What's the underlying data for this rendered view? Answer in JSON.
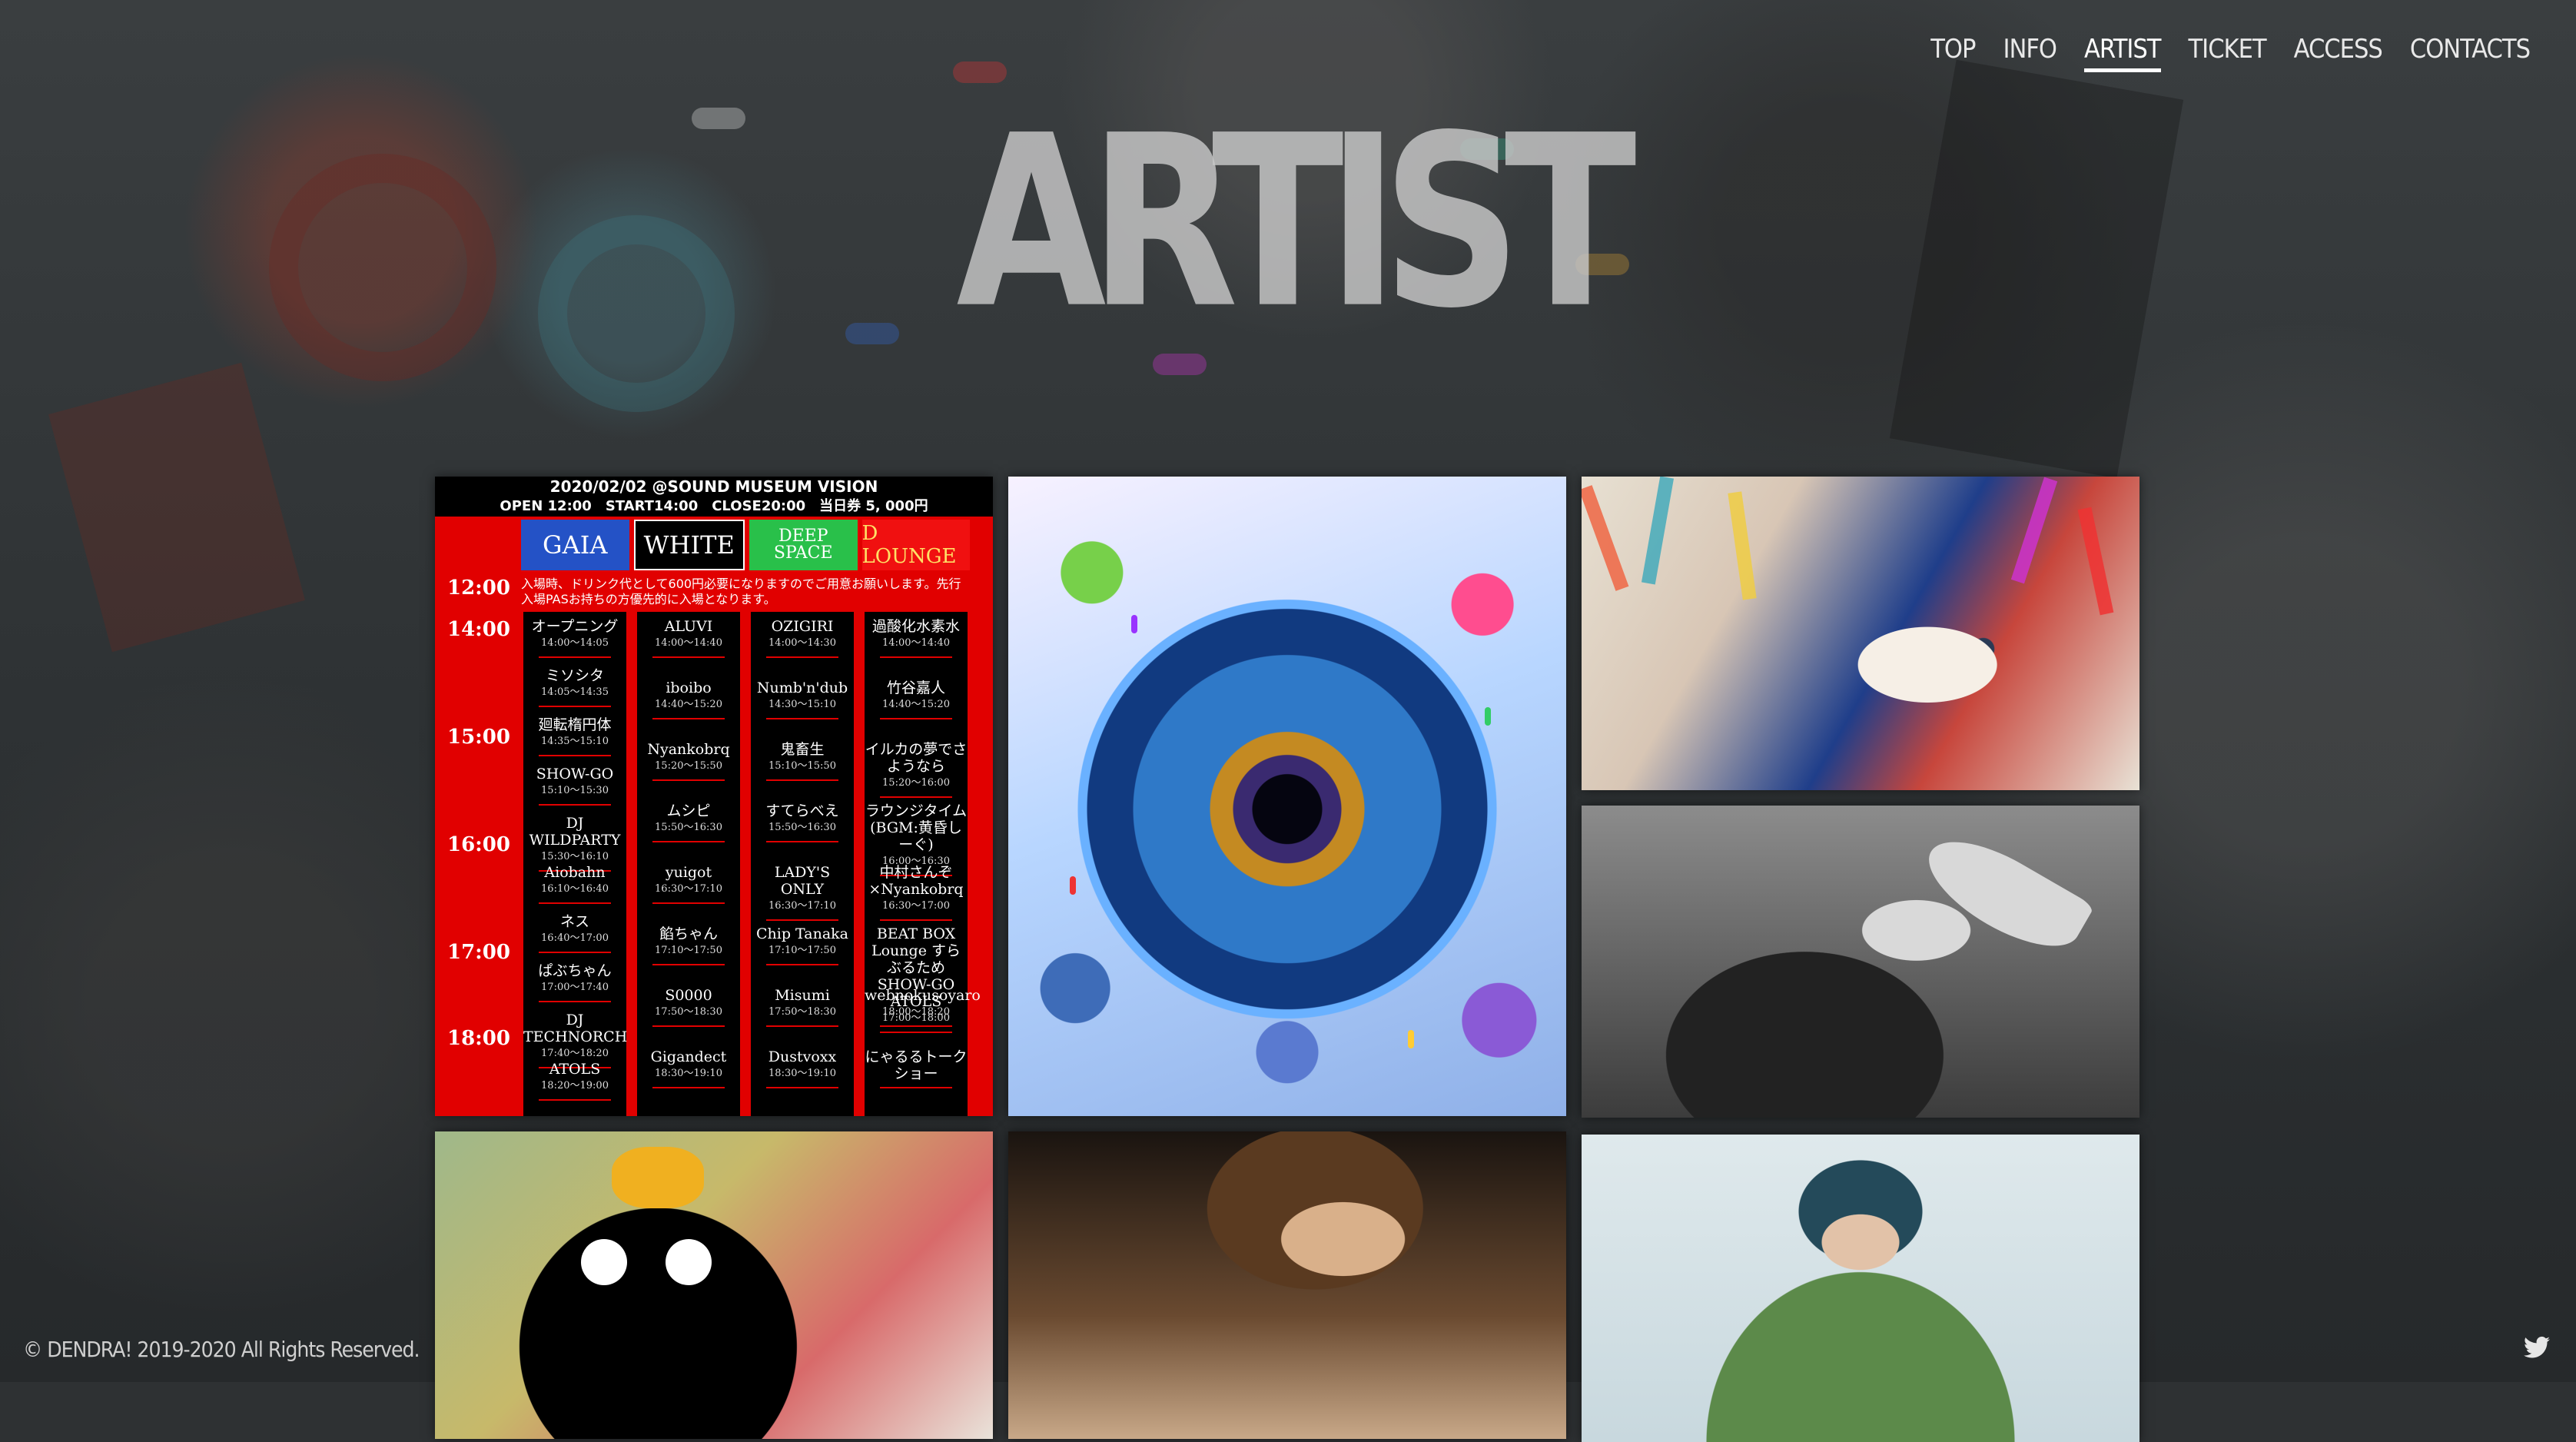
{
  "nav": {
    "items": [
      {
        "label": "TOP"
      },
      {
        "label": "INFO"
      },
      {
        "label": "ARTIST"
      },
      {
        "label": "TICKET"
      },
      {
        "label": "ACCESS"
      },
      {
        "label": "CONTACTS"
      }
    ],
    "active": "ARTIST"
  },
  "page": {
    "title": "ARTIST"
  },
  "timetable": {
    "header_line1": "2020/02/02 @SOUND MUSEUM VISION",
    "header_line2": "OPEN 12:00　START14:00　CLOSE20:00　当日券 5, 000円",
    "stages": [
      "GAIA",
      "WHITE",
      "DEEP SPACE",
      "D LOUNGE"
    ],
    "note": "入場時、ドリンク代として600円必要になりますのでご用意お願いします。先行入場PASお持ちの方優先的に入場となります。",
    "times": [
      "12:00",
      "14:00",
      "15:00",
      "16:00",
      "17:00",
      "18:00"
    ],
    "columns": [
      [
        {
          "name": "オープニング",
          "time": "14:00〜14:05"
        },
        {
          "name": "ミソシタ",
          "time": "14:05〜14:35"
        },
        {
          "name": "廻転楕円体",
          "time": "14:35〜15:10"
        },
        {
          "name": "SHOW-GO",
          "time": "15:10〜15:30"
        },
        {
          "name": "DJ WILDPARTY",
          "time": "15:30〜16:10"
        },
        {
          "name": "Aiobahn",
          "time": "16:10〜16:40"
        },
        {
          "name": "ネス",
          "time": "16:40〜17:00"
        },
        {
          "name": "ぱぶちゃん",
          "time": "17:00〜17:40"
        },
        {
          "name": "DJ TECHNORCH",
          "time": "17:40〜18:20"
        },
        {
          "name": "ATOLS",
          "time": "18:20〜19:00"
        }
      ],
      [
        {
          "name": "ALUVI",
          "time": "14:00〜14:40"
        },
        {
          "name": "iboibo",
          "time": "14:40〜15:20"
        },
        {
          "name": "Nyankobrq",
          "time": "15:20〜15:50"
        },
        {
          "name": "ムシピ",
          "time": "15:50〜16:30"
        },
        {
          "name": "yuigot",
          "time": "16:30〜17:10"
        },
        {
          "name": "餡ちゃん",
          "time": "17:10〜17:50"
        },
        {
          "name": "S0000",
          "time": "17:50〜18:30"
        },
        {
          "name": "Gigandect",
          "time": "18:30〜19:10"
        }
      ],
      [
        {
          "name": "OZIGIRI",
          "time": "14:00〜14:30"
        },
        {
          "name": "Numb'n'dub",
          "time": "14:30〜15:10"
        },
        {
          "name": "鬼畜生",
          "time": "15:10〜15:50"
        },
        {
          "name": "すてらべえ",
          "time": "15:50〜16:30"
        },
        {
          "name": "LADY'S ONLY",
          "time": "16:30〜17:10"
        },
        {
          "name": "Chip Tanaka",
          "time": "17:10〜17:50"
        },
        {
          "name": "Misumi",
          "time": "17:50〜18:30"
        },
        {
          "name": "Dustvoxx",
          "time": "18:30〜19:10"
        }
      ],
      [
        {
          "name": "過酸化水素水",
          "time": "14:00〜14:40"
        },
        {
          "name": "竹谷嘉人",
          "time": "14:40〜15:20"
        },
        {
          "name": "イルカの夢でさようなら",
          "time": "15:20〜16:00"
        },
        {
          "name": "ラウンジタイム (BGM:黄昏しーぐ)",
          "time": "16:00〜16:30"
        },
        {
          "name": "中村さんぞ×Nyankobrq",
          "time": "16:30〜17:00"
        },
        {
          "name": "BEAT BOX Lounge すらぶるため SHOW-GO ATOLS",
          "time": "17:00〜18:00"
        },
        {
          "name": "webnokusoyaro",
          "time": "18:00〜18:20"
        },
        {
          "name": "にゃるるトークショー",
          "time": ""
        }
      ]
    ]
  },
  "footer": {
    "copyright": "© DENDRA! 2019-2020 All Rights Reserved."
  },
  "icons": {
    "social": "twitter-icon"
  }
}
